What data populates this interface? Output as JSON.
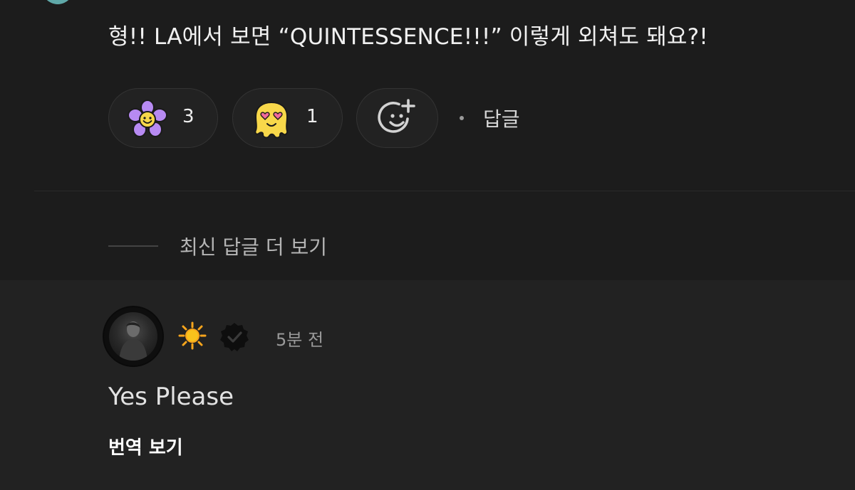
{
  "comment": {
    "text": "형!! LA에서 보면 “QUINTESSENCE!!!” 이렇게 외쳐도 돼요?!",
    "reactions": [
      {
        "icon": "purple-flower-smiley-icon",
        "count": "3"
      },
      {
        "icon": "heart-eyes-melting-face-icon",
        "count": "1"
      }
    ],
    "add_reaction_icon": "add-reaction-smiley-icon",
    "separator": "·",
    "reply_label": "답글"
  },
  "more_replies": {
    "label": "최신 답글 더 보기"
  },
  "reply": {
    "badge_icon": "sun-icon",
    "verified_icon": "verified-badge-icon",
    "time": "5분 전",
    "text": "Yes Please",
    "translate_label": "번역 보기"
  },
  "colors": {
    "background": "#1c1c1c",
    "reply_background": "#222222",
    "flower_petal": "#b78af2",
    "face_yellow": "#f8d84a",
    "heart": "#f06a9a",
    "sun": "#f8a51c"
  }
}
